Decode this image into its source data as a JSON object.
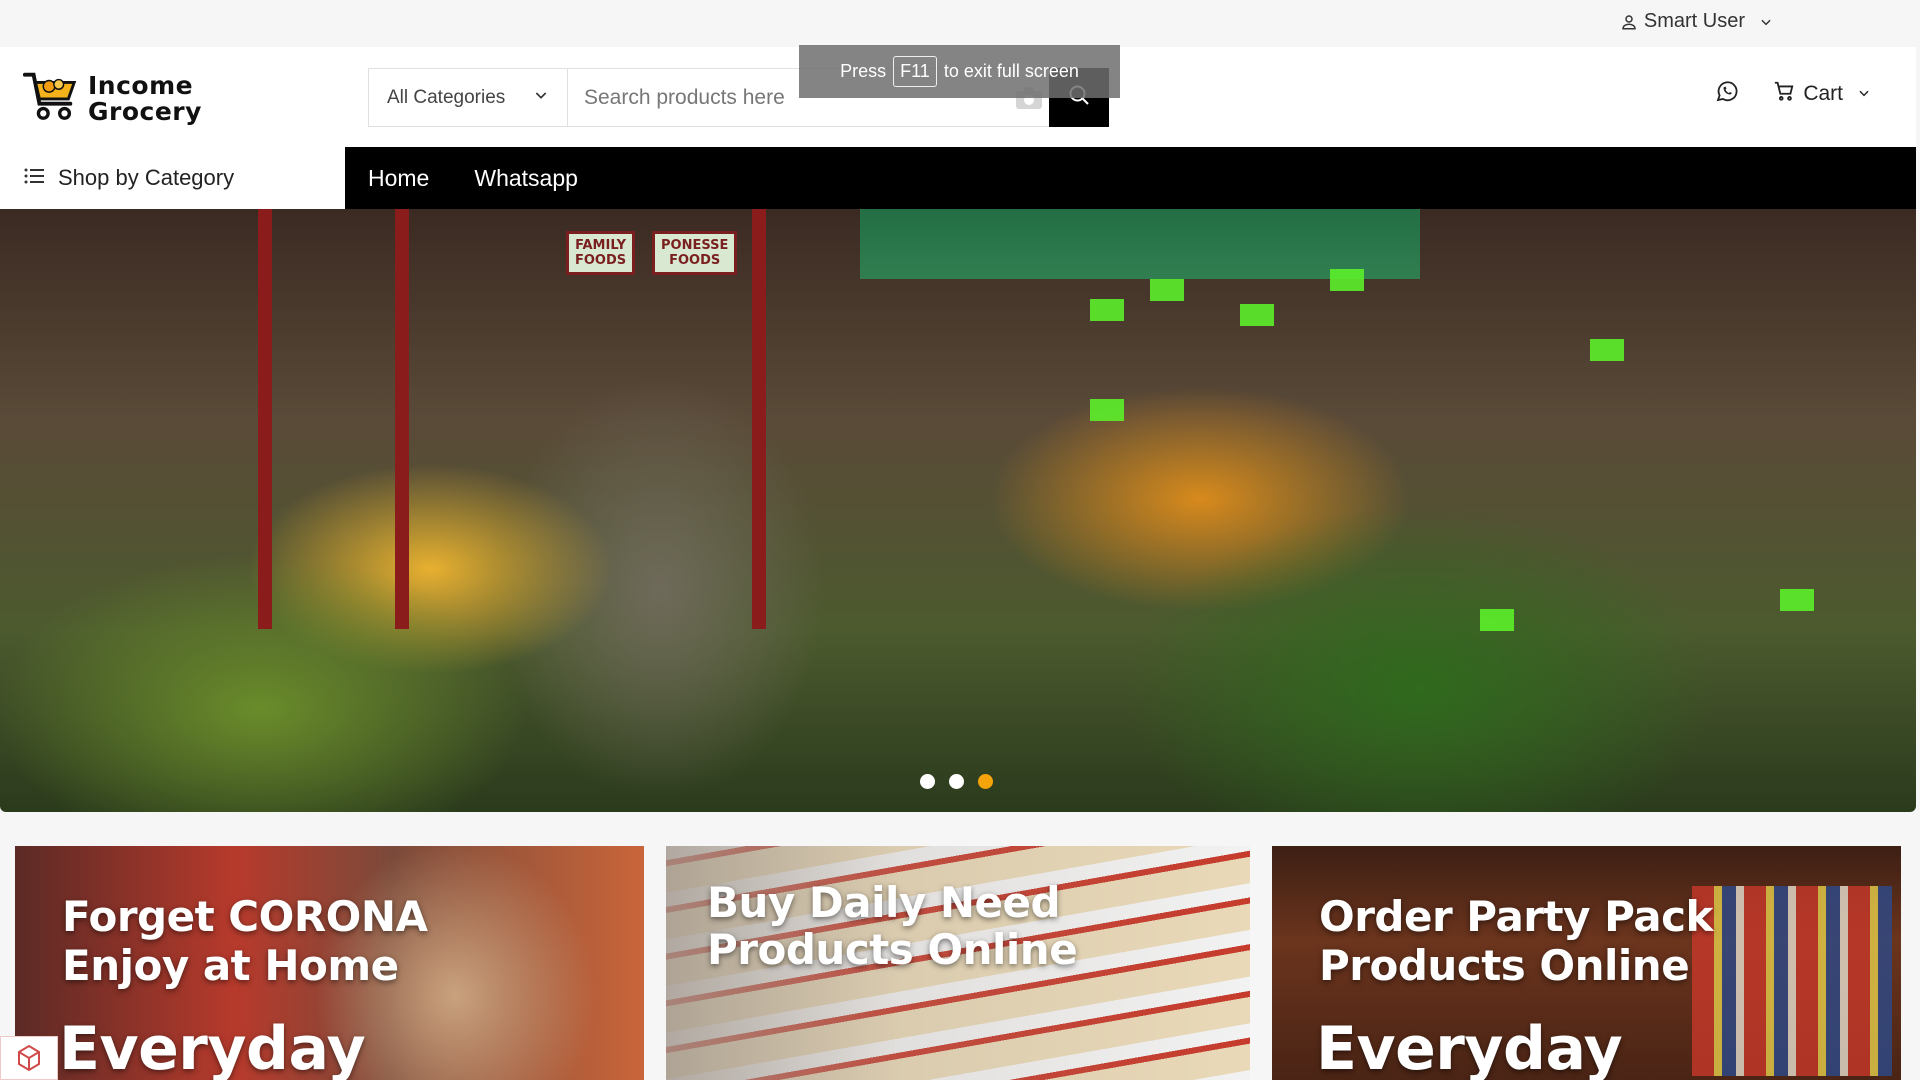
{
  "topbar": {
    "user_label": "Smart User"
  },
  "logo": {
    "line1": "Income",
    "line2": "Grocery"
  },
  "search": {
    "category_label": "All Categories",
    "placeholder": "Search products here"
  },
  "header": {
    "cart_label": "Cart"
  },
  "fullscreen_notice": {
    "press": "Press",
    "key": "F11",
    "rest": "to exit full screen"
  },
  "nav": {
    "category_label": "Shop by Category",
    "links": [
      "Home",
      "Whatsapp"
    ]
  },
  "hero": {
    "signs": [
      {
        "l1": "FAMILY",
        "l2": "FOODS"
      },
      {
        "l1": "PONESSE",
        "l2": "FOODS"
      }
    ],
    "slide_count": 3,
    "active_slide": 3
  },
  "promos": [
    {
      "line1": "Forget CORONA",
      "line2": "Enjoy at Home",
      "line3": "Everyday"
    },
    {
      "line1": "Buy Daily Need",
      "line2": "Products Online"
    },
    {
      "line1": "Order Party Pack",
      "line2": "Products Online",
      "line3": "Everyday"
    }
  ],
  "colors": {
    "nav_bg": "#000000",
    "accent": "#f5a30a",
    "search_button": "#000000"
  }
}
